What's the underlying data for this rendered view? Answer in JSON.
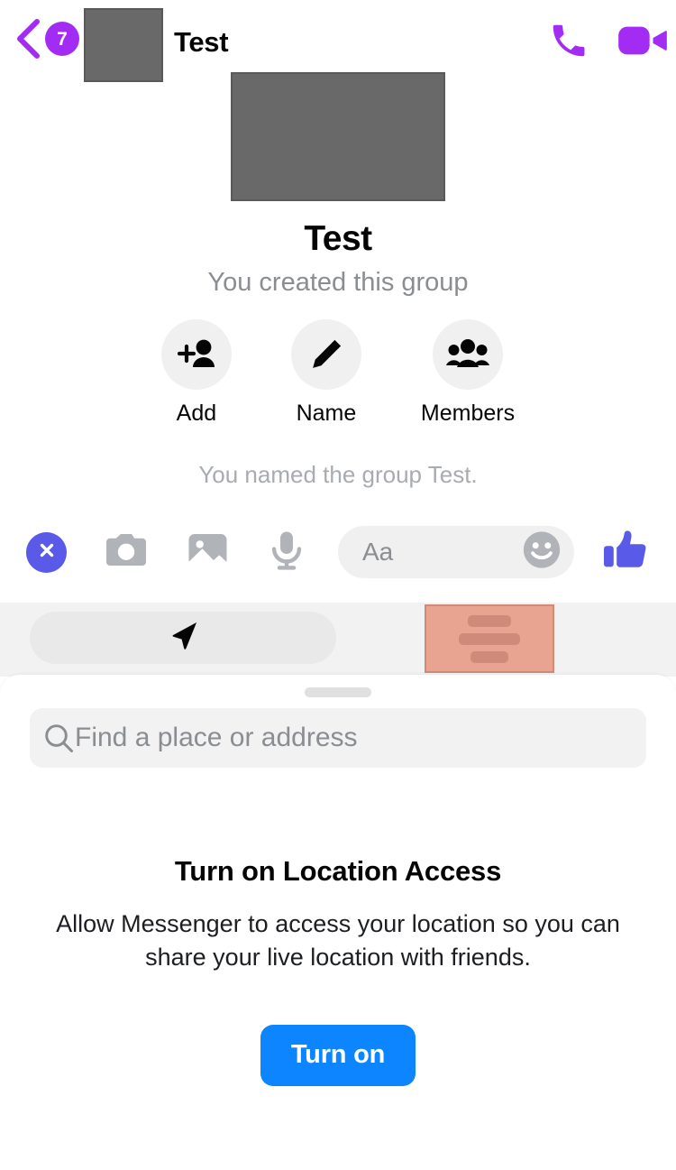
{
  "header": {
    "back_icon": "chevron-left-icon",
    "unread_badge": "7",
    "avatar_placeholder": "group-avatar-placeholder",
    "title": "Test",
    "call_icon": "phone-icon",
    "video_icon": "video-camera-icon",
    "accent_color": "#a32cf4"
  },
  "thread": {
    "group_photo_placeholder": "group-photo-placeholder",
    "group_name": "Test",
    "group_subtitle": "You created this group",
    "quick_actions": [
      {
        "label": "Add",
        "icon": "add-person-icon"
      },
      {
        "label": "Name",
        "icon": "pencil-icon"
      },
      {
        "label": "Members",
        "icon": "people-group-icon"
      }
    ],
    "system_message": "You named the group Test."
  },
  "composer": {
    "close_icon": "close-circle-icon",
    "camera_icon": "camera-icon",
    "gallery_icon": "image-icon",
    "mic_icon": "microphone-icon",
    "input_placeholder": "Aa",
    "emoji_icon": "smiley-icon",
    "like_icon": "thumbs-up-icon",
    "accent_color": "#5a5ae8"
  },
  "tabstrip": {
    "location_tab_icon": "navigation-arrow-icon",
    "list_tab_icon": "list-lines-icon",
    "list_tab_color": "#e8a391"
  },
  "sheet": {
    "grabber": "drag-handle",
    "search_icon": "search-icon",
    "search_placeholder": "Find a place or address",
    "permission": {
      "title": "Turn on Location Access",
      "body": "Allow Messenger to access your location so you can share your live location with friends.",
      "button_label": "Turn on",
      "button_color": "#0d85ff"
    }
  }
}
